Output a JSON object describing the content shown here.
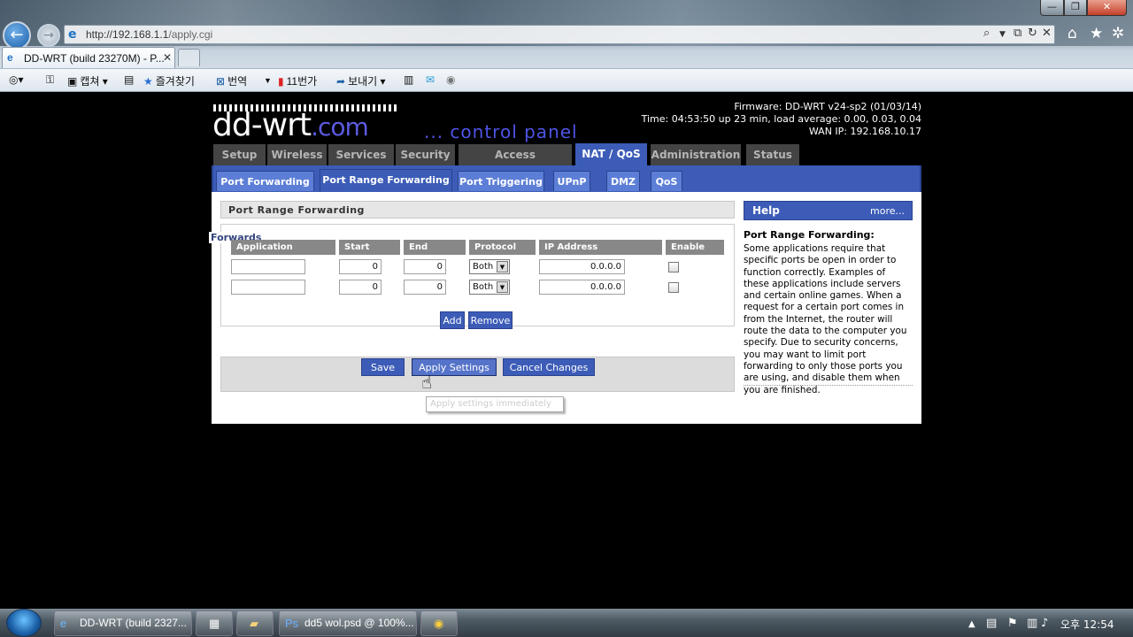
{
  "browser": {
    "url_host": "http://192.168.1.1",
    "url_path": "/apply.cgi",
    "tab_title": "DD-WRT (build 23270M) - P...",
    "command_bar": [
      {
        "label": "캡쳐",
        "icon": "capture-icon"
      },
      {
        "label": "즐겨찾기",
        "icon": "star-icon"
      },
      {
        "label": "번역",
        "icon": "translate-icon"
      },
      {
        "label": "11번가",
        "icon": "shop-icon"
      },
      {
        "label": "보내기",
        "icon": "send-icon"
      }
    ]
  },
  "header": {
    "logo_main": "dd-wrt",
    "logo_com": ".com",
    "control_panel": "... control panel",
    "firmware": "Firmware: DD-WRT v24-sp2 (01/03/14)",
    "time": "Time: 04:53:50 up 23 min, load average: 0.00, 0.03, 0.04",
    "wan_ip": "WAN IP: 192.168.10.17"
  },
  "main_tabs": [
    "Setup",
    "Wireless",
    "Services",
    "Security",
    "Access Restrictions",
    "NAT / QoS",
    "Administration",
    "Status"
  ],
  "active_main_tab": "NAT / QoS",
  "sub_tabs": [
    "Port Forwarding",
    "Port Range Forwarding",
    "Port Triggering",
    "UPnP",
    "DMZ",
    "QoS"
  ],
  "active_sub_tab": "Port Range Forwarding",
  "section": {
    "title": "Port Range Forwarding",
    "legend": "Forwards",
    "columns": [
      "Application",
      "Start",
      "End",
      "Protocol",
      "IP Address",
      "Enable"
    ],
    "rows": [
      {
        "application": "",
        "start": "0",
        "end": "0",
        "protocol": "Both",
        "ip": "0.0.0.0",
        "enabled": false
      },
      {
        "application": "",
        "start": "0",
        "end": "0",
        "protocol": "Both",
        "ip": "0.0.0.0",
        "enabled": false
      }
    ],
    "add_label": "Add",
    "remove_label": "Remove"
  },
  "actions": {
    "save": "Save",
    "apply": "Apply Settings",
    "cancel": "Cancel Changes",
    "tooltip": "Apply settings immediately"
  },
  "help": {
    "heading": "Help",
    "more": "more...",
    "title": "Port Range Forwarding:",
    "body": "Some applications require that specific ports be open in order to function correctly. Examples of these applications include servers and certain online games. When a request for a certain port comes in from the Internet, the router will route the data to the computer you specify. Due to security concerns, you may want to limit port forwarding to only those ports you are using, and disable them when you are finished."
  },
  "taskbar": {
    "items": [
      "DD-WRT (build 2327...",
      "",
      "",
      "dd5 wol.psd @ 100%...",
      ""
    ],
    "clock": "오후 12:54"
  }
}
